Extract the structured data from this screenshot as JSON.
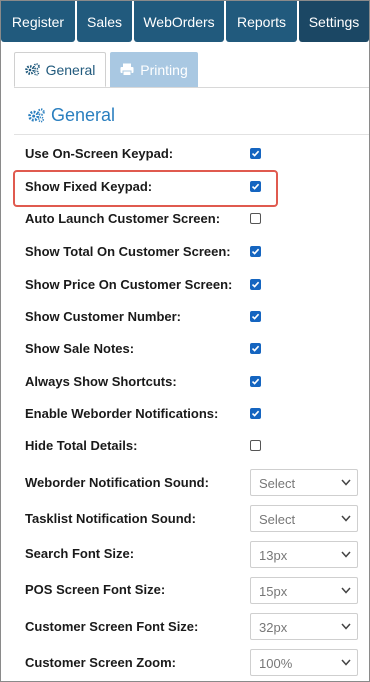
{
  "nav": {
    "register": "Register",
    "sales": "Sales",
    "weborders": "WebOrders",
    "reports": "Reports",
    "settings": "Settings"
  },
  "tabs": {
    "general": "General",
    "printing": "Printing"
  },
  "section": {
    "title": "General"
  },
  "settings": [
    {
      "label": "Use On-Screen Keypad:",
      "checked": true
    },
    {
      "label": "Show Fixed Keypad:",
      "checked": true
    },
    {
      "label": "Auto Launch Customer Screen:",
      "checked": false
    },
    {
      "label": "Show Total On Customer Screen:",
      "checked": true
    },
    {
      "label": "Show Price On Customer Screen:",
      "checked": true
    },
    {
      "label": "Show Customer Number:",
      "checked": true
    },
    {
      "label": "Show Sale Notes:",
      "checked": true
    },
    {
      "label": "Always Show Shortcuts:",
      "checked": true
    },
    {
      "label": "Enable Weborder Notifications:",
      "checked": true
    },
    {
      "label": "Hide Total Details:",
      "checked": false
    }
  ],
  "selects": [
    {
      "label": "Weborder Notification Sound:",
      "value": "Select"
    },
    {
      "label": "Tasklist Notification Sound:",
      "value": "Select"
    },
    {
      "label": "Search Font Size:",
      "value": "13px"
    },
    {
      "label": "POS Screen Font Size:",
      "value": "15px"
    },
    {
      "label": "Customer Screen Font Size:",
      "value": "32px"
    },
    {
      "label": "Customer Screen Zoom:",
      "value": "100%"
    }
  ],
  "colors": {
    "nav_bg": "#215a7d",
    "accent": "#2a7fbf",
    "checkbox": "#1565c0",
    "highlight": "#e05a4f"
  }
}
